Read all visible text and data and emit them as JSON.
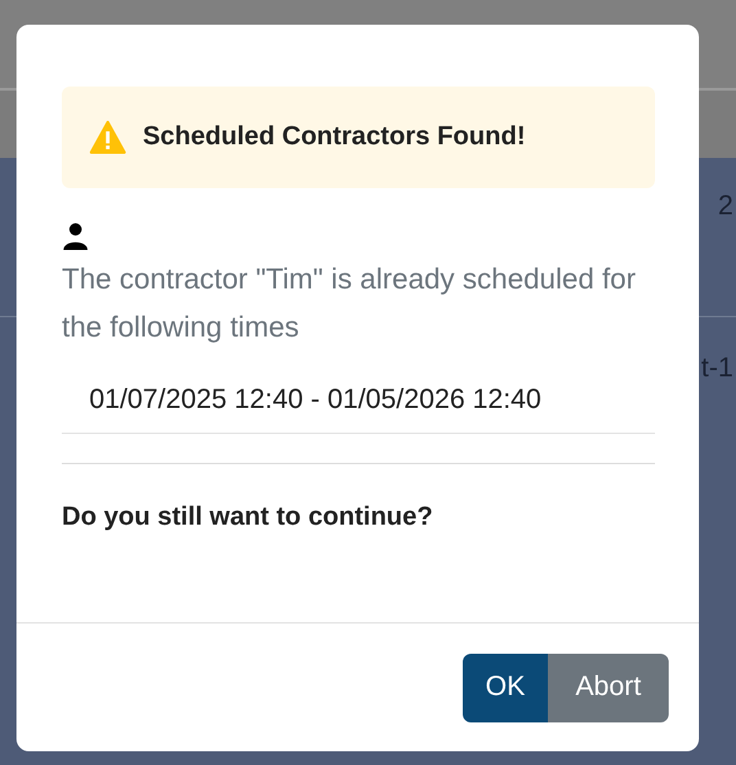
{
  "background": {
    "fragments": [
      "2",
      "t-1"
    ]
  },
  "dialog": {
    "alert": {
      "title": "Scheduled Contractors Found!"
    },
    "message": "The contractor \"Tim\" is already scheduled for the following times",
    "times": [
      "01/07/2025 12:40 - 01/05/2026 12:40"
    ],
    "question": "Do you still want to continue?",
    "buttons": [
      {
        "label": "OK",
        "kind": "primary"
      },
      {
        "label": "Abort",
        "kind": "secondary"
      }
    ]
  }
}
